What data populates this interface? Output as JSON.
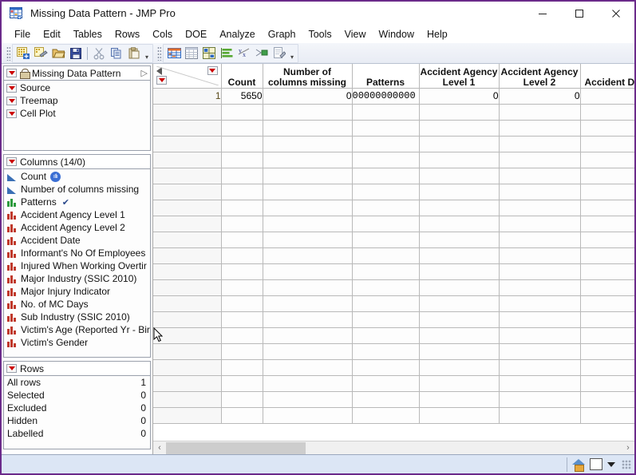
{
  "window": {
    "title": "Missing Data Pattern - JMP Pro",
    "app_icon": "table-grid-icon",
    "minimize": "—",
    "maximize": "□",
    "close": "✕"
  },
  "menubar": {
    "items": [
      "File",
      "Edit",
      "Tables",
      "Rows",
      "Cols",
      "DOE",
      "Analyze",
      "Graph",
      "Tools",
      "View",
      "Window",
      "Help"
    ]
  },
  "toolbar": {
    "groups": [
      {
        "name": "file-group",
        "buttons": [
          "new-data-table-icon",
          "new-script-icon",
          "open-file-icon",
          "save-icon",
          "cut-icon",
          "copy-icon",
          "paste-icon"
        ]
      },
      {
        "name": "analyze-group",
        "buttons": [
          "distribution-icon",
          "data-table-icon",
          "chart-icon",
          "bar-chart-icon",
          "fit-y-by-x-icon",
          "fit-model-icon",
          "script-editor-icon"
        ]
      }
    ],
    "overflow_label": "▾"
  },
  "sidebar": {
    "table_panel": {
      "title": "Missing Data Pattern",
      "lock_icon": "lock-icon",
      "expand_icon": "chevron-right-icon",
      "items": [
        "Source",
        "Treemap",
        "Cell Plot"
      ]
    },
    "columns_panel": {
      "title": "Columns (14/0)",
      "columns": [
        {
          "label": "Count",
          "type": "continuous",
          "badge": "tally",
          "check": false
        },
        {
          "label": "Number of columns missing",
          "type": "continuous",
          "badge": "",
          "check": false
        },
        {
          "label": "Patterns",
          "type": "nominal-green",
          "badge": "",
          "check": true
        },
        {
          "label": "Accident Agency Level 1",
          "type": "nominal",
          "badge": "",
          "check": false
        },
        {
          "label": "Accident Agency Level 2",
          "type": "nominal",
          "badge": "",
          "check": false
        },
        {
          "label": "Accident Date",
          "type": "nominal",
          "badge": "",
          "check": false
        },
        {
          "label": "Informant's No Of Employees",
          "type": "nominal",
          "badge": "",
          "check": false
        },
        {
          "label": "Injured When Working Overtir",
          "type": "nominal",
          "badge": "",
          "check": false
        },
        {
          "label": "Major Industry (SSIC 2010)",
          "type": "nominal",
          "badge": "",
          "check": false
        },
        {
          "label": "Major Injury Indicator",
          "type": "nominal",
          "badge": "",
          "check": false
        },
        {
          "label": "No. of MC Days",
          "type": "nominal",
          "badge": "",
          "check": false
        },
        {
          "label": "Sub Industry  (SSIC 2010)",
          "type": "nominal",
          "badge": "",
          "check": false
        },
        {
          "label": "Victim's Age (Reported Yr - Bir",
          "type": "nominal",
          "badge": "",
          "check": false
        },
        {
          "label": "Victim's Gender",
          "type": "nominal",
          "badge": "",
          "check": false
        }
      ]
    },
    "rows_panel": {
      "title": "Rows",
      "stats": [
        {
          "label": "All rows",
          "value": "1"
        },
        {
          "label": "Selected",
          "value": "0"
        },
        {
          "label": "Excluded",
          "value": "0"
        },
        {
          "label": "Hidden",
          "value": "0"
        },
        {
          "label": "Labelled",
          "value": "0"
        }
      ]
    }
  },
  "table": {
    "headers": [
      "Count",
      "Number of\ncolumns missing",
      "Patterns",
      "Accident Agency\nLevel 1",
      "Accident Agency\nLevel 2",
      "Accident Da"
    ],
    "header_lines": [
      {
        "l1": "",
        "l2": "Count"
      },
      {
        "l1": "Number of",
        "l2": "columns missing"
      },
      {
        "l1": "",
        "l2": "Patterns"
      },
      {
        "l1": "Accident Agency",
        "l2": "Level 1"
      },
      {
        "l1": "Accident Agency",
        "l2": "Level 2"
      },
      {
        "l1": "",
        "l2": "Accident Da"
      }
    ],
    "rows": [
      {
        "num": "1",
        "count": "5650",
        "cols_missing": "0",
        "patterns": "00000000000",
        "agency1": "0",
        "agency2": "0",
        "accident_date": ""
      }
    ],
    "empty_row_count": 21
  },
  "scrollbar": {
    "left_arrow": "‹",
    "right_arrow": "›"
  },
  "statusbar": {
    "home_icon": "home-icon",
    "box_icon": "white-square-icon",
    "caret_icon": "caret-down-icon"
  },
  "colors": {
    "window_border": "#6b2a8a",
    "accent_red": "#cc0000",
    "continuous_blue": "#3a6fb5",
    "nominal_red": "#c0392b",
    "status_bg": "#dce6f5"
  }
}
